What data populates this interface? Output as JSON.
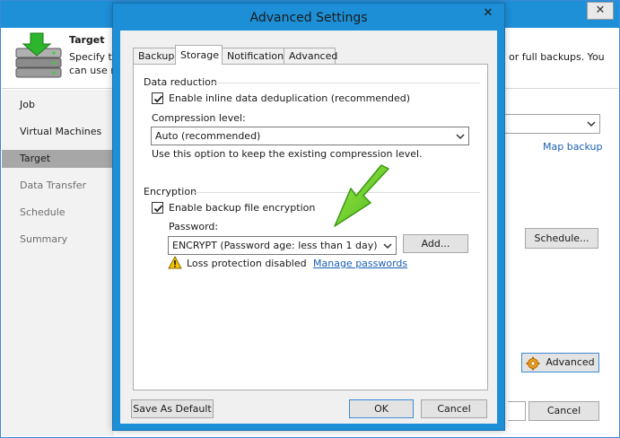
{
  "background_window": {
    "close_glyph": "✕",
    "header": {
      "title": "Target",
      "description_line1": "Specify the",
      "description_line2": "can use ma",
      "description_right": "or full backups. You"
    },
    "nav_items": [
      {
        "label": "Job",
        "state": "normal"
      },
      {
        "label": "Virtual Machines",
        "state": "normal"
      },
      {
        "label": "Target",
        "state": "active"
      },
      {
        "label": "Data Transfer",
        "state": "dim"
      },
      {
        "label": "Schedule",
        "state": "dim"
      },
      {
        "label": "Summary",
        "state": "dim"
      }
    ],
    "map_backup_link": "Map backup",
    "schedule_button": "Schedule...",
    "advanced_button": "Advanced",
    "cancel_button": "Cancel"
  },
  "dialog": {
    "title": "Advanced Settings",
    "close_glyph": "✕",
    "tabs": [
      {
        "label": "Backup",
        "active": false
      },
      {
        "label": "Storage",
        "active": true
      },
      {
        "label": "Notifications",
        "active": false
      },
      {
        "label": "Advanced",
        "active": false
      }
    ],
    "data_reduction": {
      "group_title": "Data reduction",
      "dedup_label": "Enable inline data deduplication (recommended)",
      "dedup_checked": true,
      "compression_label": "Compression level:",
      "compression_value": "Auto (recommended)",
      "compression_hint": "Use this option to keep the existing compression level."
    },
    "encryption": {
      "group_title": "Encryption",
      "enable_label": "Enable backup file encryption",
      "enable_checked": true,
      "password_label": "Password:",
      "password_value": "ENCRYPT (Password age: less than 1 day)",
      "add_button": "Add...",
      "warning_text": "Loss protection disabled",
      "manage_link": "Manage passwords"
    },
    "save_default_button": "Save As Default",
    "ok_button": "OK",
    "cancel_button": "Cancel"
  },
  "colors": {
    "titlebar": "#1d8fd6",
    "link": "#1a5fb4",
    "arrow": "#6ad21e",
    "warning": "#f5c400"
  }
}
